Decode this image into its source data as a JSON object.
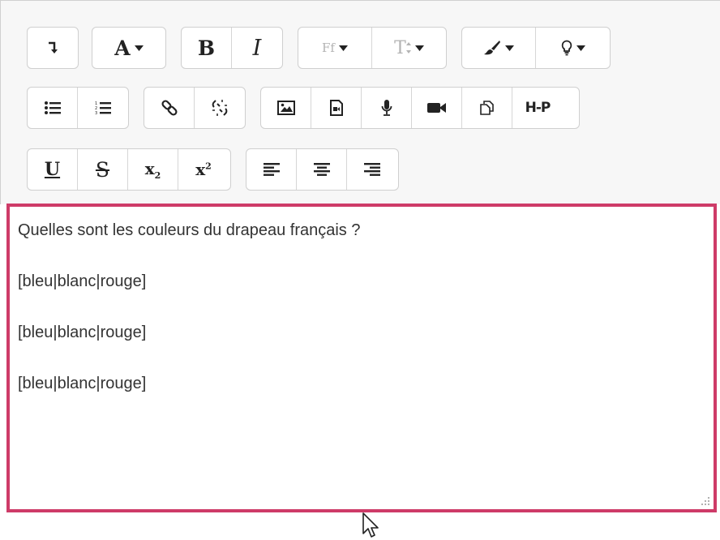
{
  "toolbar": {
    "row1": {
      "paragraph_icon": "paragraph-style-icon",
      "font_color_label": "A",
      "bold_label": "B",
      "italic_label": "I",
      "font_family_label": "Ff",
      "font_size_label": "T",
      "brush_icon": "brush-icon",
      "lightbulb_icon": "lightbulb-icon"
    },
    "row2": {
      "bullet_list_icon": "bullet-list-icon",
      "numbered_list_icon": "numbered-list-icon",
      "link_icon": "link-icon",
      "unlink_icon": "unlink-icon",
      "image_icon": "image-icon",
      "media_icon": "media-icon",
      "audio_icon": "microphone-icon",
      "video_icon": "video-camera-icon",
      "manage_files_icon": "copy-files-icon",
      "h5p_label": "H-P"
    },
    "row3": {
      "underline_label": "U",
      "strikethrough_label": "S",
      "subscript_label": "x",
      "subscript_mark": "2",
      "superscript_label": "x",
      "superscript_mark": "2",
      "align_left_icon": "align-left-icon",
      "align_center_icon": "align-center-icon",
      "align_right_icon": "align-right-icon"
    }
  },
  "content": {
    "question": "Quelles sont les couleurs du drapeau français ?",
    "lines": [
      "[bleu|blanc|rouge]",
      "[bleu|blanc|rouge]",
      "[bleu|blanc|rouge]"
    ]
  },
  "colors": {
    "focus_border": "#ce3b68",
    "toolbar_bg": "#f7f7f7"
  }
}
